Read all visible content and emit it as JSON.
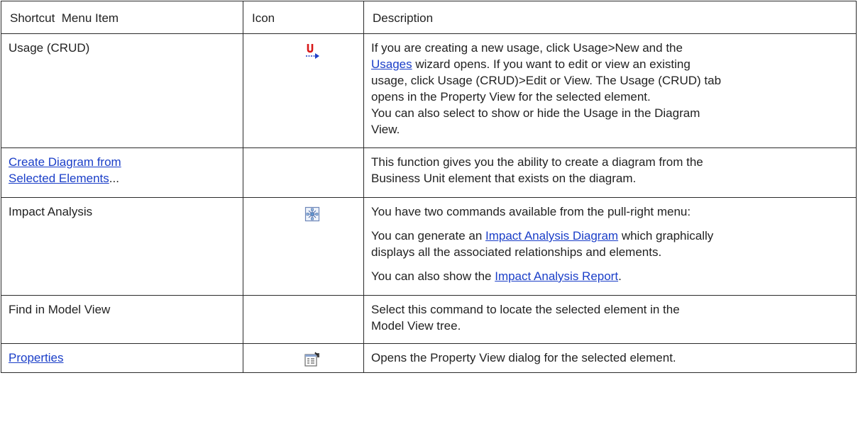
{
  "headers": {
    "item": "Shortcut  Menu Item",
    "icon": "Icon",
    "description": "Description"
  },
  "rows": {
    "usage": {
      "item": "Usage (CRUD)",
      "icon": "usage-crud-icon",
      "desc_l1": "If you are creating a new usage, click Usage>New and the",
      "desc_link": "Usages",
      "desc_l2_rest": " wizard opens. If you want to edit or view an existing",
      "desc_l3": "usage, click Usage (CRUD)>Edit or View. The Usage (CRUD) tab",
      "desc_l4": "opens in the Property View for the selected element.",
      "desc_l5": "You can also select to show or hide the Usage in the Diagram",
      "desc_l6": "View."
    },
    "create_diagram": {
      "item_link_l1": "Create Diagram from",
      "item_link_l2": "Selected Elements",
      "item_suffix": "...",
      "desc_l1": "This function gives you the ability to create a diagram from the",
      "desc_l2": "Business Unit element that exists on the diagram."
    },
    "impact": {
      "item": "Impact Analysis",
      "icon": "impact-analysis-icon",
      "p1": "You have two commands available from the pull-right menu:",
      "p2_pre": "You can generate an ",
      "p2_link": "Impact Analysis Diagram",
      "p2_post": " which graphically",
      "p2_l2": "displays all the associated relationships and elements.",
      "p3_pre": "You can also show the ",
      "p3_link": "Impact Analysis Report",
      "p3_post": "."
    },
    "find": {
      "item": "Find in Model View",
      "desc_l1": "Select this command to locate the selected element in the",
      "desc_l2": "Model View tree."
    },
    "properties": {
      "item_link": "Properties",
      "icon": "properties-icon",
      "desc": "Opens the Property View dialog for the selected element."
    }
  },
  "colors": {
    "link": "#1a3ec8",
    "border": "#2a2a2a",
    "usage_icon_red": "#d81818",
    "usage_icon_blue": "#1f3fc8"
  }
}
